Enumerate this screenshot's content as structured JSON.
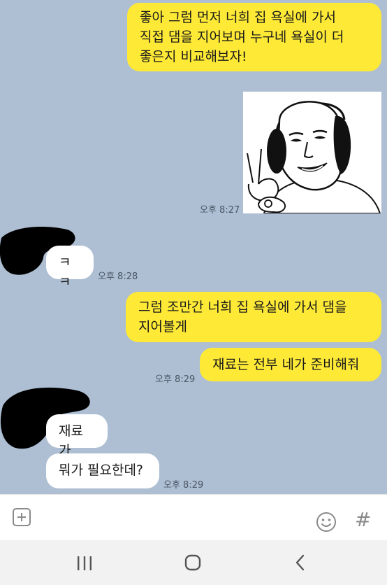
{
  "messages": [
    {
      "id": "m1",
      "side": "mine",
      "lines": [
        "좋아 그럼 먼저 너희 집 욕실에 가서",
        "직접 댐을 지어보며 누구네 욕실이 더",
        "좋은지 비교해보자!"
      ]
    },
    {
      "id": "m2",
      "side": "mine",
      "type": "sticker",
      "sticker": "grinning-man-ok-hand-sticker",
      "time": "오후 8:27"
    },
    {
      "id": "m3",
      "side": "theirs",
      "lines": [
        "ㅋㅋ"
      ],
      "time": "오후 8:28"
    },
    {
      "id": "m4",
      "side": "mine",
      "lines": [
        "그럼 조만간 너희 집 욕실에 가서 댐을",
        "지어볼게"
      ]
    },
    {
      "id": "m5",
      "side": "mine",
      "lines": [
        "재료는 전부 네가 준비해줘"
      ],
      "time": "오후 8:29"
    },
    {
      "id": "m6",
      "side": "theirs",
      "lines": [
        "재료가"
      ]
    },
    {
      "id": "m7",
      "side": "theirs",
      "lines": [
        "뭐가 필요한데?"
      ],
      "time": "오후 8:29"
    }
  ],
  "input_bar": {
    "plus_icon": "plus-square-icon",
    "emoji_icon": "smiley-icon",
    "hash_label": "#"
  },
  "nav_bar": {
    "recent_icon": "recent-apps-icon",
    "home_icon": "home-icon",
    "back_icon": "back-chevron-icon"
  },
  "colors": {
    "chat_bg": "#aebfd3",
    "my_bubble": "#fde936",
    "their_bubble": "#ffffff"
  }
}
